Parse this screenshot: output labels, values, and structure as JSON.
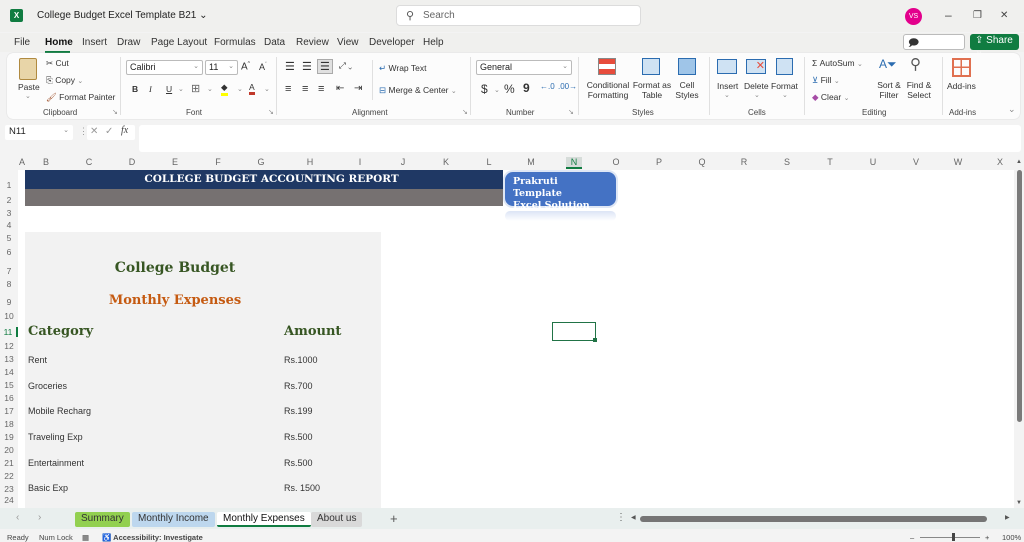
{
  "app": {
    "title": "College Budget Excel Template B21",
    "logo": "X",
    "search_placeholder": "Search",
    "user_initials": "VS",
    "window_controls": {
      "minimize": "–",
      "restore": "❐",
      "close": "✕"
    }
  },
  "menu": {
    "items": [
      "File",
      "Home",
      "Insert",
      "Draw",
      "Page Layout",
      "Formulas",
      "Data",
      "Review",
      "View",
      "Developer",
      "Help"
    ],
    "active": "Home",
    "comments": "Comments",
    "share": "Share"
  },
  "ribbon": {
    "clipboard": {
      "label": "Clipboard",
      "paste": "Paste",
      "cut": "Cut",
      "copy": "Copy",
      "format_painter": "Format Painter"
    },
    "font": {
      "label": "Font",
      "font_name": "Calibri",
      "font_size": "11",
      "bold": "B",
      "italic": "I",
      "underline": "U"
    },
    "alignment": {
      "label": "Alignment",
      "wrap_text": "Wrap Text",
      "merge_center": "Merge & Center"
    },
    "number": {
      "label": "Number",
      "format": "General",
      "currency": "$",
      "percent": "%",
      "comma": "9"
    },
    "styles": {
      "label": "Styles",
      "conditional": "Conditional Formatting",
      "format_table": "Format as Table",
      "cell_styles": "Cell Styles"
    },
    "cells": {
      "label": "Cells",
      "insert": "Insert",
      "delete": "Delete",
      "format": "Format"
    },
    "editing": {
      "label": "Editing",
      "autosum": "AutoSum",
      "fill": "Fill",
      "clear": "Clear",
      "sort_filter": "Sort & Filter",
      "find_select": "Find & Select"
    },
    "addins": {
      "label": "Add-ins",
      "addins": "Add-ins"
    }
  },
  "formula_bar": {
    "name_box": "N11",
    "fx": "fx",
    "value": ""
  },
  "columns": [
    "A",
    "B",
    "C",
    "D",
    "E",
    "F",
    "G",
    "H",
    "I",
    "J",
    "K",
    "L",
    "M",
    "N",
    "O",
    "P",
    "Q",
    "R",
    "S",
    "T",
    "U",
    "V",
    "W",
    "X"
  ],
  "rows": [
    "1",
    "2",
    "3",
    "4",
    "5",
    "6",
    "7",
    "8",
    "9",
    "10",
    "11",
    "12",
    "13",
    "14",
    "15",
    "16",
    "17",
    "18",
    "19",
    "20",
    "21",
    "22",
    "23",
    "24"
  ],
  "sheet": {
    "banner_title": "COLLEGE BUDGET ACCOUNTING REPORT",
    "shape_text": [
      "Prakruti Template",
      "Excel Solution"
    ],
    "heading": "College Budget",
    "subheading": "Monthly Expenses",
    "category_header": "Category",
    "amount_header": "Amount",
    "expenses": [
      {
        "category": "Rent",
        "amount": "Rs.1000"
      },
      {
        "category": "Groceries",
        "amount": "Rs.700"
      },
      {
        "category": "Mobile Recharg",
        "amount": "Rs.199"
      },
      {
        "category": "Traveling Exp",
        "amount": "Rs.500"
      },
      {
        "category": "Entertainment",
        "amount": "Rs.500"
      },
      {
        "category": "Basic Exp",
        "amount": "Rs. 1500"
      }
    ]
  },
  "tabs": [
    {
      "label": "Summary",
      "color": "#92d050"
    },
    {
      "label": "Monthly Income",
      "color": "#bdd7ee"
    },
    {
      "label": "Monthly Expenses",
      "color": "#ffffff",
      "active": true
    },
    {
      "label": "About us",
      "color": "#d9d9d9"
    }
  ],
  "status": {
    "ready": "Ready",
    "num_lock": "Num Lock",
    "accessibility": "Accessibility: Investigate",
    "zoom": "100%"
  }
}
